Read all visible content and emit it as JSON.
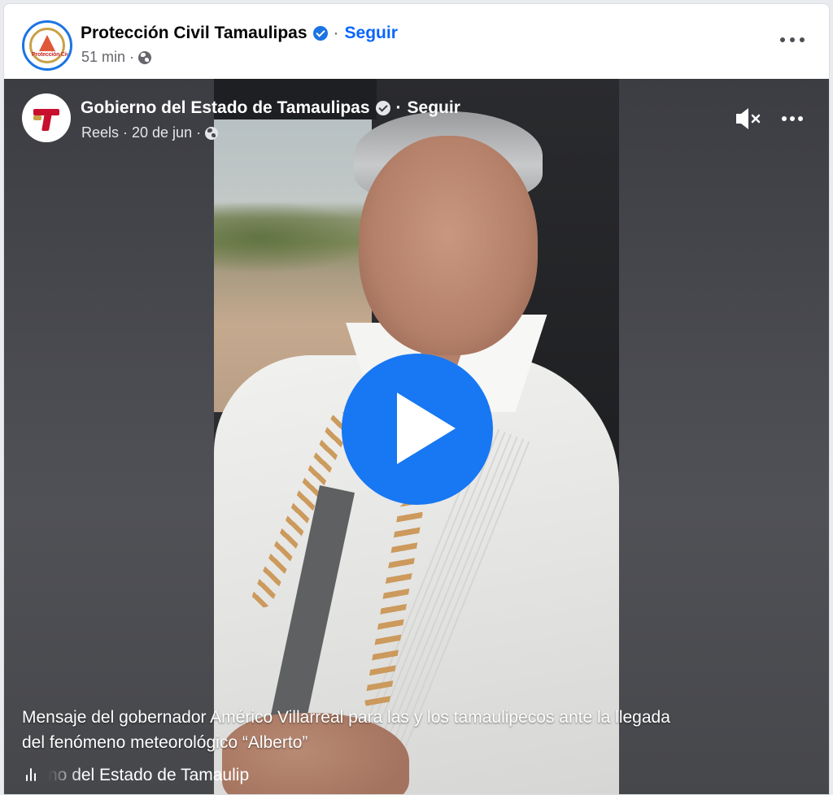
{
  "post": {
    "author": "Protección Civil Tamaulipas",
    "avatar_text": "Protección Civil",
    "separator": "·",
    "follow_label": "Seguir",
    "time": "51 min ·",
    "privacy_icon": "globe-icon",
    "menu_icon": "more-horizontal-icon"
  },
  "reel": {
    "author": "Gobierno del Estado de Tamaulipas",
    "separator": "·",
    "follow_label": "Seguir",
    "meta": "Reels · 20 de jun ·",
    "privacy_icon": "globe-icon",
    "mute_icon": "speaker-muted-icon",
    "menu_icon": "more-horizontal-icon",
    "play_icon": "play-icon",
    "caption": "Mensaje del gobernador Américo Villarreal para las y los tamaulipecos ante la llegada del fenómeno meteorológico “Alberto”",
    "audio_track": "no del Estado de Tamaulip",
    "audio_icon": "audio-waveform-icon"
  },
  "colors": {
    "accent": "#1877f2",
    "link": "#0866ff",
    "verified": "#1b74e4",
    "video_bg": "#4a4b50"
  }
}
